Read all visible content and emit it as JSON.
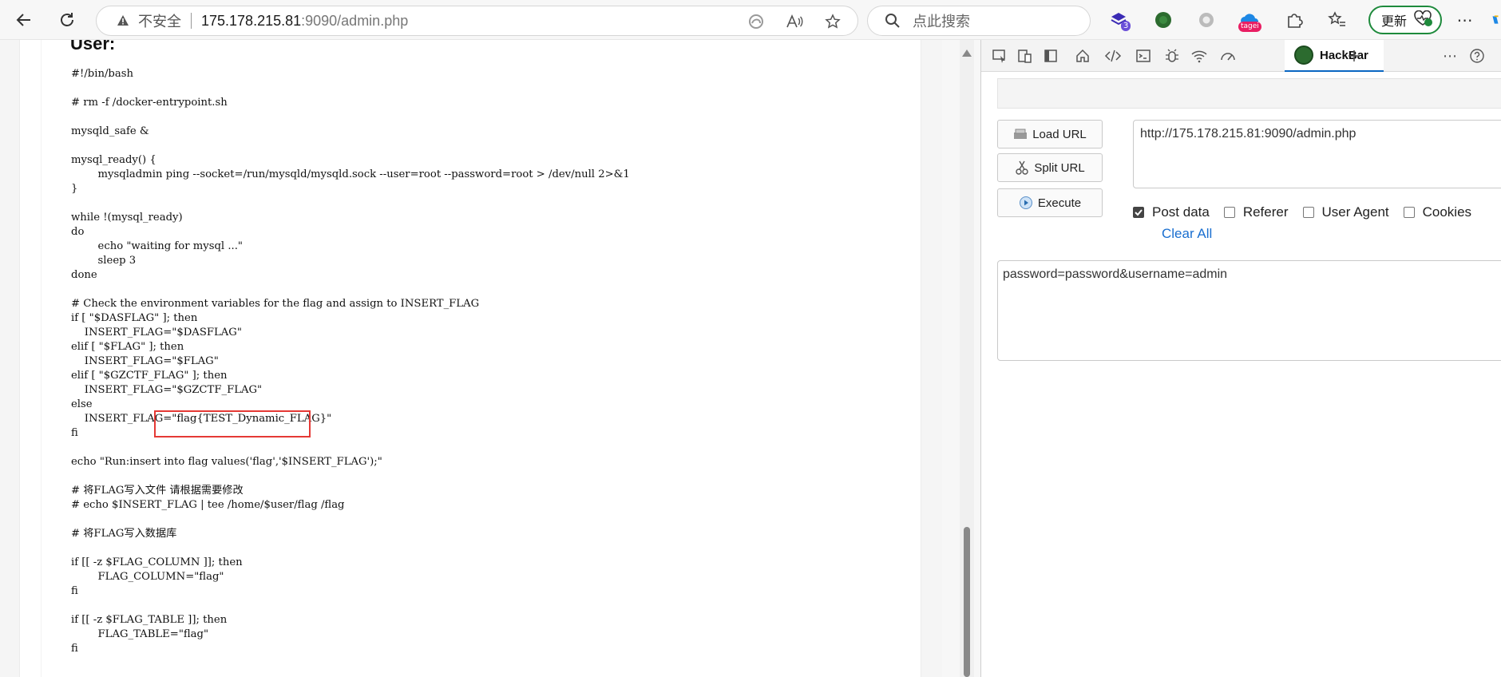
{
  "browser": {
    "address": {
      "security_label": "不安全",
      "host": "175.178.215.81",
      "path": ":9090/admin.php"
    },
    "search_placeholder": "点此搜索",
    "update_label": "更新",
    "ext_badges": {
      "first": "3",
      "tagei": "tagei"
    }
  },
  "page": {
    "title": "User:",
    "code_lines": [
      "#!/bin/bash",
      "",
      "# rm -f /docker-entrypoint.sh",
      "",
      "mysqld_safe &",
      "",
      "mysql_ready() {",
      "        mysqladmin ping --socket=/run/mysqld/mysqld.sock --user=root --password=root > /dev/null 2>&1",
      "}",
      "",
      "while !(mysql_ready)",
      "do",
      "        echo \"waiting for mysql ...\"",
      "        sleep 3",
      "done",
      "",
      "# Check the environment variables for the flag and assign to INSERT_FLAG",
      "if [ \"$DASFLAG\" ]; then",
      "    INSERT_FLAG=\"$DASFLAG\"",
      "elif [ \"$FLAG\" ]; then",
      "    INSERT_FLAG=\"$FLAG\"",
      "elif [ \"$GZCTF_FLAG\" ]; then",
      "    INSERT_FLAG=\"$GZCTF_FLAG\"",
      "else",
      "    INSERT_FLAG=\"flag{TEST_Dynamic_FLAG}\"",
      "fi",
      "",
      "echo \"Run:insert into flag values('flag','$INSERT_FLAG');\"",
      "",
      "# 将FLAG写入文件 请根据需要修改",
      "# echo $INSERT_FLAG | tee /home/$user/flag /flag",
      "",
      "# 将FLAG写入数据库",
      "",
      "if [[ -z $FLAG_COLUMN ]]; then",
      "        FLAG_COLUMN=\"flag\"",
      "fi",
      "",
      "if [[ -z $FLAG_TABLE ]]; then",
      "        FLAG_TABLE=\"flag\"",
      "fi"
    ]
  },
  "devtools": {
    "active_tab": "HackBar",
    "hackbar": {
      "load_url": "Load URL",
      "split_url": "Split URL",
      "execute": "Execute",
      "url_value": "http://175.178.215.81:9090/admin.php",
      "options": [
        {
          "label": "Post data",
          "checked": true
        },
        {
          "label": "Referer",
          "checked": false
        },
        {
          "label": "User Agent",
          "checked": false
        },
        {
          "label": "Cookies",
          "checked": false
        }
      ],
      "clear_all": "Clear All",
      "post_value": "password=password&username=admin"
    }
  },
  "colors": {
    "highlight_box": "#e53935",
    "accent_link": "#1a6fd0",
    "update_border": "#1e8a3c"
  }
}
